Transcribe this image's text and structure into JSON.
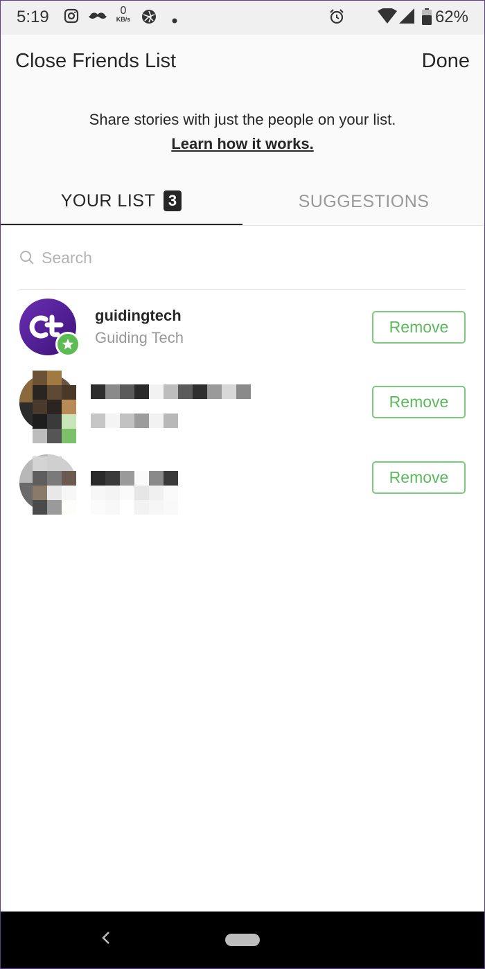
{
  "status_bar": {
    "time": "5:19",
    "net_speed_value": "0",
    "net_speed_unit": "KB/s",
    "battery": "62%",
    "icons": [
      "instagram-icon",
      "mustache-icon",
      "aperture-icon",
      "dot-icon",
      "alarm-icon",
      "wifi-icon",
      "signal-icon",
      "battery-icon"
    ]
  },
  "header": {
    "title": "Close Friends List",
    "done_label": "Done",
    "subtitle": "Share stories with just the people on your list.",
    "learn_link": "Learn how it works."
  },
  "tabs": [
    {
      "label": "YOUR LIST",
      "count": "3",
      "active": true
    },
    {
      "label": "SUGGESTIONS",
      "active": false
    }
  ],
  "search": {
    "placeholder": "Search",
    "value": ""
  },
  "friends": [
    {
      "username": "guidingtech",
      "full_name": "Guiding Tech",
      "button_label": "Remove"
    },
    {
      "username": "",
      "full_name": "",
      "button_label": "Remove"
    },
    {
      "username": "",
      "full_name": "",
      "button_label": "Remove"
    }
  ],
  "colors": {
    "accent_green": "#5cb85c",
    "text_primary": "#262626",
    "text_secondary": "#999999",
    "avatar_purple": "#5b24a0"
  }
}
